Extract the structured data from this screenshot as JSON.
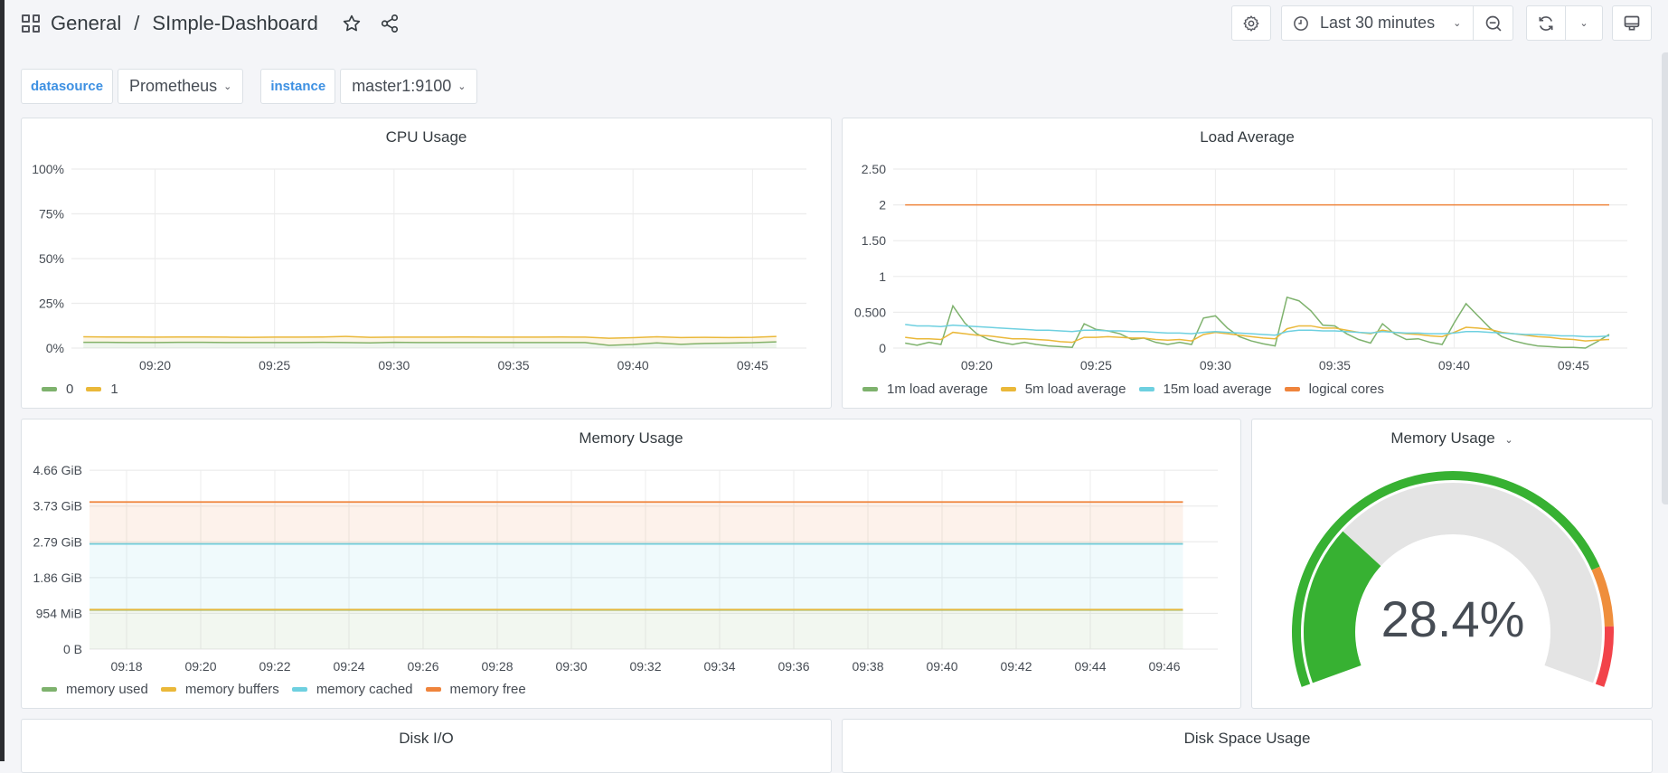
{
  "header": {
    "breadcrumb_root": "General",
    "breadcrumb_sep": "/",
    "dashboard_title": "SImple-Dashboard",
    "icons": {
      "apps": "grid-icon",
      "favorite": "star-icon",
      "share": "share-icon",
      "settings": "gear-icon",
      "time": "clock-icon",
      "zoom_out": "zoom-out-icon",
      "refresh": "refresh-icon",
      "refresh_interval": "chevron-down-icon",
      "tv_mode": "monitor-icon"
    },
    "time_range": "Last 30 minutes"
  },
  "variables": [
    {
      "label": "datasource",
      "value": "Prometheus"
    },
    {
      "label": "instance",
      "value": "master1:9100"
    }
  ],
  "colors": {
    "green": "#7eb26d",
    "yellow": "#eab839",
    "cyan": "#6ed0e0",
    "orange": "#ef843c",
    "gauge_green": "#37b132",
    "gauge_orange": "#ef8e3c",
    "gauge_red": "#f2434a",
    "link_blue": "#3d90e2"
  },
  "panels": {
    "cpu": {
      "title": "CPU Usage"
    },
    "load": {
      "title": "Load Average"
    },
    "memory": {
      "title": "Memory Usage"
    },
    "gauge": {
      "title": "Memory Usage",
      "value_text": "28.4%"
    },
    "disk_io": {
      "title": "Disk I/O"
    },
    "disk_space": {
      "title": "Disk Space Usage"
    }
  },
  "chart_data": [
    {
      "id": "cpu",
      "type": "area",
      "stacked": true,
      "title": "CPU Usage",
      "ylim": [
        0,
        100
      ],
      "yticks": [
        "0%",
        "25%",
        "50%",
        "75%",
        "100%"
      ],
      "ytick_values": [
        0,
        25,
        50,
        75,
        100
      ],
      "xlim": [
        "09:16:30",
        "09:46:30"
      ],
      "xticks": [
        "09:20",
        "09:25",
        "09:30",
        "09:35",
        "09:40",
        "09:45"
      ],
      "legend": "bottom-left",
      "x": [
        "09:17",
        "09:18",
        "09:19",
        "09:20",
        "09:21",
        "09:22",
        "09:23",
        "09:24",
        "09:25",
        "09:26",
        "09:27",
        "09:28",
        "09:29",
        "09:30",
        "09:31",
        "09:32",
        "09:33",
        "09:34",
        "09:35",
        "09:36",
        "09:37",
        "09:38",
        "09:39",
        "09:40",
        "09:41",
        "09:42",
        "09:43",
        "09:44",
        "09:45",
        "09:46"
      ],
      "series": [
        {
          "name": "0",
          "color": "#7eb26d",
          "values": [
            3.2,
            3.2,
            3.1,
            3.1,
            3.2,
            3.2,
            3.1,
            3.1,
            3.1,
            3.1,
            3.2,
            3.1,
            2.9,
            3.2,
            3.1,
            3.1,
            3.1,
            3.1,
            3.1,
            3.1,
            3.1,
            3.1,
            1.5,
            2.0,
            2.9,
            2.1,
            2.6,
            2.8,
            3.0,
            3.5
          ]
        },
        {
          "name": "1",
          "color": "#eab839",
          "values": [
            3.1,
            3.0,
            3.1,
            3.0,
            3.0,
            3.0,
            3.0,
            2.9,
            3.0,
            3.0,
            3.0,
            3.4,
            3.1,
            2.9,
            3.0,
            3.0,
            3.1,
            3.0,
            3.0,
            3.0,
            3.1,
            3.0,
            4.0,
            3.8,
            3.4,
            3.8,
            3.4,
            3.1,
            3.0,
            3.0
          ]
        }
      ]
    },
    {
      "id": "load",
      "type": "line",
      "title": "Load Average",
      "ylim": [
        0,
        2.5
      ],
      "yticks": [
        "0",
        "0.500",
        "1",
        "1.50",
        "2",
        "2.50"
      ],
      "ytick_values": [
        0,
        0.5,
        1,
        1.5,
        2,
        2.5
      ],
      "xlim": [
        "09:16:30",
        "09:46:30"
      ],
      "xticks": [
        "09:20",
        "09:25",
        "09:30",
        "09:35",
        "09:40",
        "09:45"
      ],
      "legend": "bottom-left",
      "x_minutes": [
        17,
        17.5,
        18,
        18.5,
        19,
        19.5,
        20,
        20.5,
        21,
        21.5,
        22,
        22.5,
        23,
        23.5,
        24,
        24.5,
        25,
        25.5,
        26,
        26.5,
        27,
        27.5,
        28,
        28.5,
        29,
        29.5,
        30,
        30.5,
        31,
        31.5,
        32,
        32.5,
        33,
        33.5,
        34,
        34.5,
        35,
        35.5,
        36,
        36.5,
        37,
        37.5,
        38,
        38.5,
        39,
        39.5,
        40,
        40.5,
        41,
        41.5,
        42,
        42.5,
        43,
        43.5,
        44,
        44.5,
        45,
        45.5,
        46,
        46.5
      ],
      "series": [
        {
          "name": "1m load average",
          "color": "#7eb26d",
          "values": [
            0.07,
            0.04,
            0.08,
            0.05,
            0.59,
            0.35,
            0.2,
            0.12,
            0.08,
            0.05,
            0.08,
            0.05,
            0.03,
            0.02,
            0.01,
            0.34,
            0.26,
            0.24,
            0.2,
            0.12,
            0.14,
            0.08,
            0.05,
            0.08,
            0.05,
            0.42,
            0.45,
            0.28,
            0.16,
            0.1,
            0.06,
            0.03,
            0.71,
            0.66,
            0.52,
            0.32,
            0.31,
            0.2,
            0.12,
            0.07,
            0.34,
            0.2,
            0.12,
            0.13,
            0.08,
            0.05,
            0.35,
            0.62,
            0.45,
            0.28,
            0.16,
            0.1,
            0.06,
            0.03,
            0.02,
            0.01,
            0.01,
            0.0,
            0.09,
            0.19
          ]
        },
        {
          "name": "5m load average",
          "color": "#eab839",
          "values": [
            0.15,
            0.13,
            0.13,
            0.12,
            0.22,
            0.2,
            0.18,
            0.17,
            0.15,
            0.13,
            0.13,
            0.12,
            0.11,
            0.09,
            0.08,
            0.15,
            0.15,
            0.16,
            0.15,
            0.14,
            0.14,
            0.12,
            0.11,
            0.12,
            0.1,
            0.19,
            0.22,
            0.2,
            0.18,
            0.16,
            0.14,
            0.13,
            0.27,
            0.31,
            0.31,
            0.28,
            0.28,
            0.25,
            0.22,
            0.2,
            0.25,
            0.22,
            0.2,
            0.19,
            0.17,
            0.16,
            0.22,
            0.29,
            0.28,
            0.26,
            0.22,
            0.2,
            0.18,
            0.16,
            0.15,
            0.13,
            0.12,
            0.1,
            0.11,
            0.12
          ]
        },
        {
          "name": "15m load average",
          "color": "#6ed0e0",
          "values": [
            0.33,
            0.31,
            0.31,
            0.3,
            0.32,
            0.31,
            0.3,
            0.29,
            0.28,
            0.27,
            0.26,
            0.25,
            0.25,
            0.24,
            0.23,
            0.25,
            0.25,
            0.24,
            0.24,
            0.23,
            0.23,
            0.22,
            0.21,
            0.21,
            0.2,
            0.22,
            0.23,
            0.22,
            0.21,
            0.2,
            0.19,
            0.18,
            0.23,
            0.25,
            0.25,
            0.24,
            0.24,
            0.23,
            0.22,
            0.21,
            0.23,
            0.22,
            0.21,
            0.21,
            0.2,
            0.2,
            0.21,
            0.23,
            0.23,
            0.22,
            0.21,
            0.2,
            0.19,
            0.19,
            0.18,
            0.17,
            0.17,
            0.16,
            0.16,
            0.17
          ]
        },
        {
          "name": "logical cores",
          "color": "#ef843c",
          "values": [
            2,
            2,
            2,
            2,
            2,
            2,
            2,
            2,
            2,
            2,
            2,
            2,
            2,
            2,
            2,
            2,
            2,
            2,
            2,
            2,
            2,
            2,
            2,
            2,
            2,
            2,
            2,
            2,
            2,
            2,
            2,
            2,
            2,
            2,
            2,
            2,
            2,
            2,
            2,
            2,
            2,
            2,
            2,
            2,
            2,
            2,
            2,
            2,
            2,
            2,
            2,
            2,
            2,
            2,
            2,
            2,
            2,
            2,
            2,
            2
          ]
        }
      ]
    },
    {
      "id": "memory",
      "type": "area",
      "stacked": true,
      "title": "Memory Usage",
      "unit": "GiB",
      "ylim": [
        0,
        4.66
      ],
      "yticks": [
        "0 B",
        "954 MiB",
        "1.86 GiB",
        "2.79 GiB",
        "3.73 GiB",
        "4.66 GiB"
      ],
      "ytick_values": [
        0,
        0.9317,
        1.8626,
        2.794,
        3.7253,
        4.6566
      ],
      "xlim": [
        "09:17:00",
        "09:47:00"
      ],
      "xticks": [
        "09:18",
        "09:20",
        "09:22",
        "09:24",
        "09:26",
        "09:28",
        "09:30",
        "09:32",
        "09:34",
        "09:36",
        "09:38",
        "09:40",
        "09:42",
        "09:44",
        "09:46"
      ],
      "legend": "bottom-left",
      "series": [
        {
          "name": "memory used",
          "color": "#7eb26d",
          "values_const": 1.02
        },
        {
          "name": "memory buffers",
          "color": "#eab839",
          "values_const": 0.01
        },
        {
          "name": "memory cached",
          "color": "#6ed0e0",
          "values_const": 1.71
        },
        {
          "name": "memory free",
          "color": "#ef843c",
          "values_const": 1.09
        }
      ]
    },
    {
      "id": "gauge",
      "type": "gauge",
      "title": "Memory Usage",
      "value": 28.4,
      "unit": "%",
      "min": 0,
      "max": 100,
      "thresholds": [
        {
          "from": 0,
          "to": 80,
          "color": "#37b132"
        },
        {
          "from": 80,
          "to": 90,
          "color": "#ef8e3c"
        },
        {
          "from": 90,
          "to": 100,
          "color": "#f2434a"
        }
      ]
    }
  ]
}
